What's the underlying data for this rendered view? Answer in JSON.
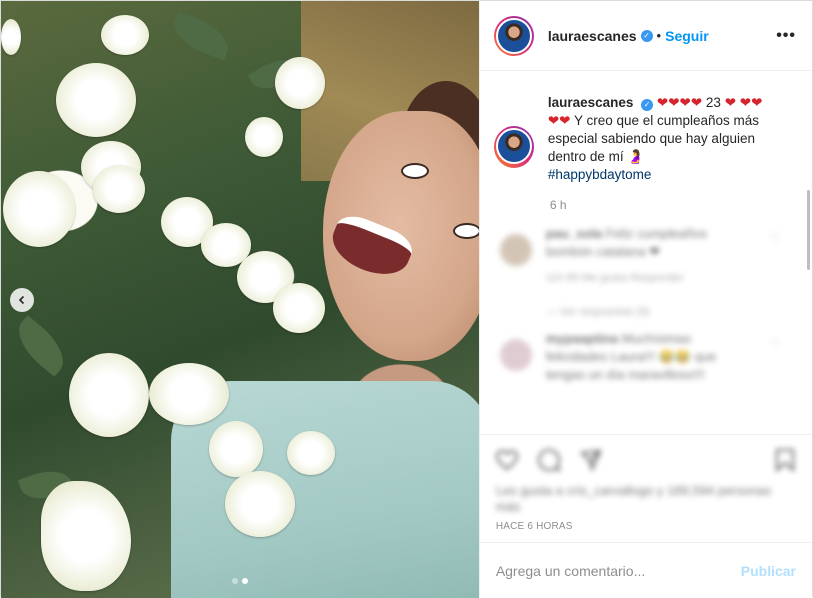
{
  "post": {
    "username": "laurascanes",
    "follow_label": "Seguir",
    "separator": "•",
    "more_label": "•••"
  },
  "caption": {
    "username": "lauraescanes",
    "emojis_hearts_1": "❤❤❤❤",
    "age": "23",
    "emojis_hearts_2": "❤",
    "emojis_hearts_3": "❤❤❤❤",
    "body": "Y creo que el cumpleaños más especial sabiendo que hay alguien dentro de mí",
    "emoji_end": "🤰",
    "hashtag": "#happybdaytome",
    "time_ago": "6 h"
  },
  "blurred_comments": [
    {
      "user": "pau_sola",
      "text_line1": "Feliz cumpleaños",
      "text_line2": "bombón catalana ❤",
      "meta": "11h   89 Me gusta   Responder",
      "replies": "—  Ver respuestas (8)"
    },
    {
      "user": "mypaaptina",
      "text_line1": "Muchísimas",
      "text_line2": "felicidades Laura!!! 😂😂 que",
      "meta": "tengas un día maravilloso!!!",
      "replies": ""
    }
  ],
  "likes_text": "Les gusta a cris_carvallogo y 189,594 personas más",
  "posted": "HACE 6 HORAS",
  "comment_box": {
    "placeholder": "Agrega un comentario...",
    "publish_label": "Publicar"
  },
  "colors": {
    "accent": "#0095f6",
    "publish_disabled": "#b2dffc",
    "verified": "#3897f0"
  },
  "icons": [
    "chevron-left-icon",
    "heart-icon",
    "comment-icon",
    "share-icon",
    "bookmark-icon",
    "verified-badge-icon",
    "more-icon"
  ],
  "carousel": {
    "slides": 2,
    "active_index": 1
  }
}
